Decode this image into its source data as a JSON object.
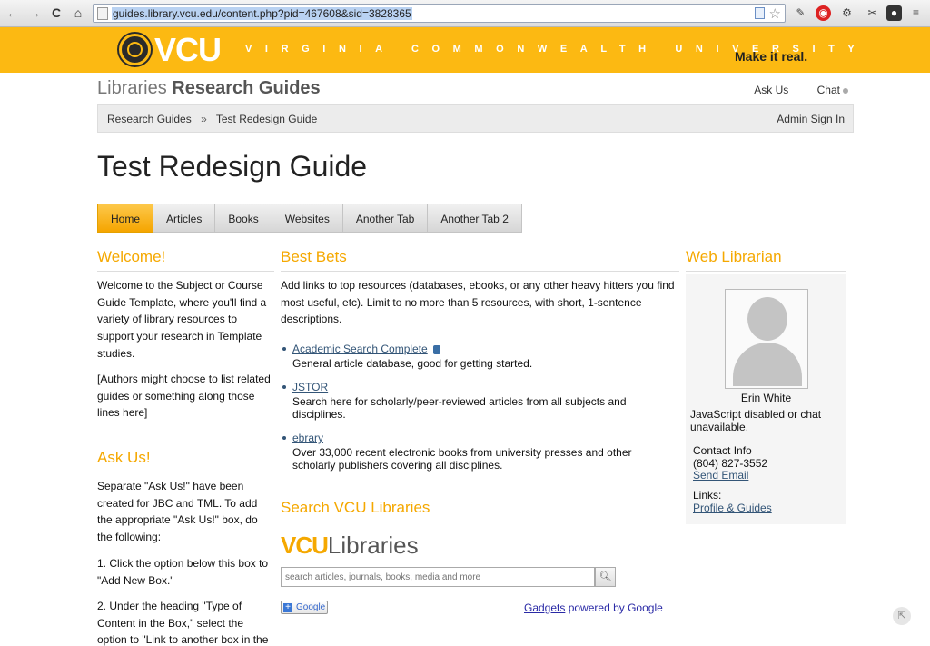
{
  "browser": {
    "url": "guides.library.vcu.edu/content.php?pid=467608&sid=3828365",
    "back": "←",
    "forward": "→",
    "reload": "C",
    "home": "⌂",
    "star": "☆"
  },
  "banner": {
    "logo": "VCU",
    "tagline": "VIRGINIA COMMONWEALTH UNIVERSITY",
    "slogan": "Make it real.",
    "color": "#fcb912"
  },
  "header": {
    "title_light": "Libraries ",
    "title_bold": "Research Guides",
    "ask_us": "Ask Us",
    "chat": "Chat"
  },
  "breadcrumb": {
    "items": [
      "Research Guides",
      "Test Redesign Guide"
    ],
    "separator": "»",
    "admin": "Admin Sign In"
  },
  "page": {
    "title": "Test Redesign Guide"
  },
  "tabs": [
    "Home",
    "Articles",
    "Books",
    "Websites",
    "Another Tab",
    "Another Tab 2"
  ],
  "left": {
    "welcome_title": "Welcome!",
    "welcome_p1": "Welcome to the Subject or Course Guide Template, where you'll find a variety of library resources to support your research in Template studies.",
    "welcome_p2": "[Authors might choose to list related guides or something along those lines here]",
    "ask_title": "Ask Us!",
    "ask_p1": "Separate \"Ask Us!\" have been created for JBC and TML. To add the appropriate \"Ask Us!\" box, do the following:",
    "ask_p2": "1. Click the option below this box to \"Add New Box.\"",
    "ask_p3": "2. Under the heading \"Type of Content in the Box,\" select the option to \"Link to another box in the"
  },
  "center": {
    "bestbets_title": "Best Bets",
    "bestbets_intro": "Add links to top resources (databases, ebooks, or any other heavy hitters you find most useful, etc).  Limit to no more than 5 resources, with short, 1-sentence descriptions.",
    "items": [
      {
        "name": "Academic Search Complete",
        "desc": "General article database, good for getting started."
      },
      {
        "name": "JSTOR",
        "desc": "Search here for scholarly/peer-reviewed articles from all subjects and disciplines."
      },
      {
        "name": "ebrary",
        "desc": "Over 33,000 recent electronic books from university presses and other scholarly publishers covering all disciplines."
      }
    ],
    "search_title": "Search VCU Libraries",
    "logo_bold": "VCU",
    "logo_light": "Libraries",
    "search_placeholder": "search articles, journals, books, media and more",
    "google_badge": "Google",
    "gadgets_link": "Gadgets",
    "gadgets_text": " powered by Google"
  },
  "right": {
    "title": "Web Librarian",
    "name": "Erin White",
    "status": "JavaScript disabled or chat unavailable.",
    "contact_label": "Contact Info",
    "phone": "(804) 827-3552",
    "email": "Send Email",
    "links_label": "Links:",
    "profile": "Profile & Guides"
  }
}
